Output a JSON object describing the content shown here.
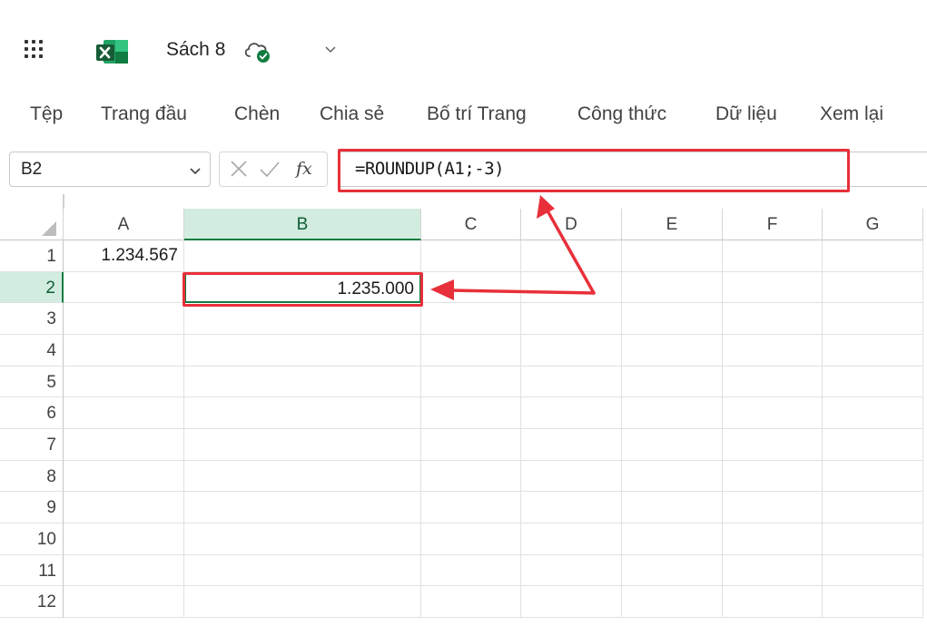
{
  "app": {
    "doc_title": "Sách 8",
    "accent": "#107c41",
    "annotation_color": "#e8303a"
  },
  "icons": [
    "waffle-icon",
    "excel-logo-icon",
    "cloud-saved-icon",
    "chevron-down-icon",
    "cancel-icon",
    "enter-icon",
    "fx-icon"
  ],
  "ribbon": {
    "tabs": [
      "Tệp",
      "Trang đầu",
      "Chèn",
      "Chia sẻ",
      "Bố trí Trang",
      "Công thức",
      "Dữ liệu",
      "Xem lại"
    ]
  },
  "formula_bar": {
    "name_box": "B2",
    "fx_label": "fx",
    "formula": "=ROUNDUP(A1;-3)"
  },
  "grid": {
    "columns": [
      "A",
      "B",
      "C",
      "D",
      "E",
      "F",
      "G"
    ],
    "rows": [
      "1",
      "2",
      "3",
      "4",
      "5",
      "6",
      "7",
      "8",
      "9",
      "10",
      "11",
      "12"
    ],
    "selected_column": "B",
    "selected_row": "2",
    "cells": {
      "A1": "1.234.567",
      "B2": "1.235.000"
    }
  }
}
